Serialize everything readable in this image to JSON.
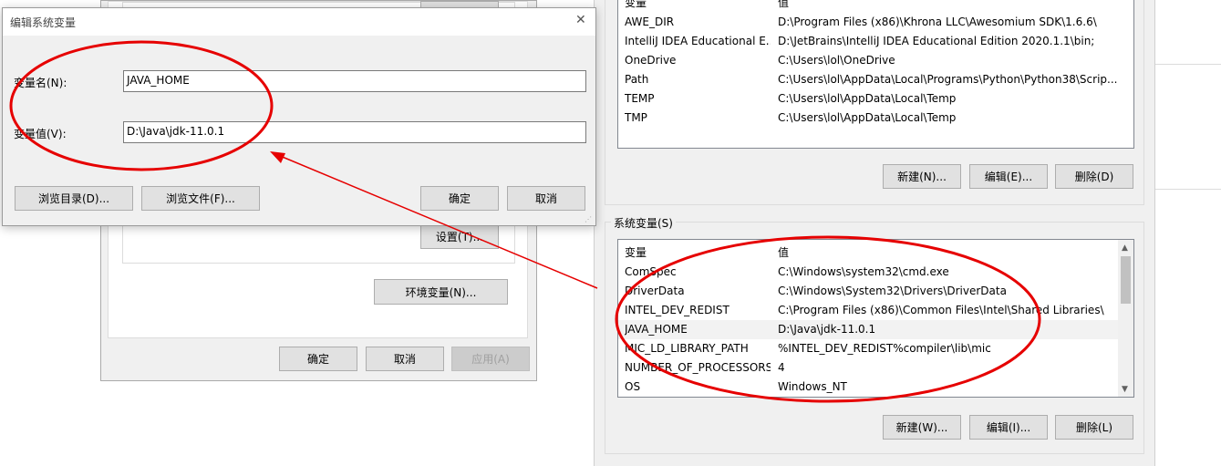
{
  "edit_dialog": {
    "title": "编辑系统变量",
    "close_symbol": "✕",
    "name_label": "变量名(N):",
    "name_value": "JAVA_HOME",
    "value_label": "变量值(V):",
    "value_value": "D:\\Java\\jdk-11.0.1",
    "browse_dir_button": "浏览目录(D)...",
    "browse_file_button": "浏览文件(F)...",
    "ok_button": "确定",
    "cancel_button": "取消"
  },
  "back_dialog": {
    "settings_button": "设置(T)...",
    "env_vars_button": "环境变量(N)...",
    "ok_button": "确定",
    "cancel_button": "取消",
    "apply_button": "应用(A)"
  },
  "user_vars": {
    "header_name": "变量",
    "header_value": "值",
    "rows": [
      {
        "name": "AWE_DIR",
        "value": "D:\\Program Files (x86)\\Khrona LLC\\Awesomium SDK\\1.6.6\\"
      },
      {
        "name": "IntelliJ IDEA Educational E...",
        "value": "D:\\JetBrains\\IntelliJ IDEA Educational Edition 2020.1.1\\bin;"
      },
      {
        "name": "OneDrive",
        "value": "C:\\Users\\lol\\OneDrive"
      },
      {
        "name": "Path",
        "value": "C:\\Users\\lol\\AppData\\Local\\Programs\\Python\\Python38\\Scrip..."
      },
      {
        "name": "TEMP",
        "value": "C:\\Users\\lol\\AppData\\Local\\Temp"
      },
      {
        "name": "TMP",
        "value": "C:\\Users\\lol\\AppData\\Local\\Temp"
      }
    ],
    "new_button": "新建(N)...",
    "edit_button": "编辑(E)...",
    "delete_button": "删除(D)"
  },
  "system_vars": {
    "group_label": "系统变量(S)",
    "header_name": "变量",
    "header_value": "值",
    "rows": [
      {
        "name": "ComSpec",
        "value": "C:\\Windows\\system32\\cmd.exe"
      },
      {
        "name": "DriverData",
        "value": "C:\\Windows\\System32\\Drivers\\DriverData"
      },
      {
        "name": "INTEL_DEV_REDIST",
        "value": "C:\\Program Files (x86)\\Common Files\\Intel\\Shared Libraries\\"
      },
      {
        "name": "JAVA_HOME",
        "value": "D:\\Java\\jdk-11.0.1"
      },
      {
        "name": "MIC_LD_LIBRARY_PATH",
        "value": "%INTEL_DEV_REDIST%compiler\\lib\\mic"
      },
      {
        "name": "NUMBER_OF_PROCESSORS",
        "value": "4"
      },
      {
        "name": "OS",
        "value": "Windows_NT"
      }
    ],
    "new_button": "新建(W)...",
    "edit_button": "编辑(I)...",
    "delete_button": "删除(L)"
  },
  "annotation_color": "#e60000"
}
